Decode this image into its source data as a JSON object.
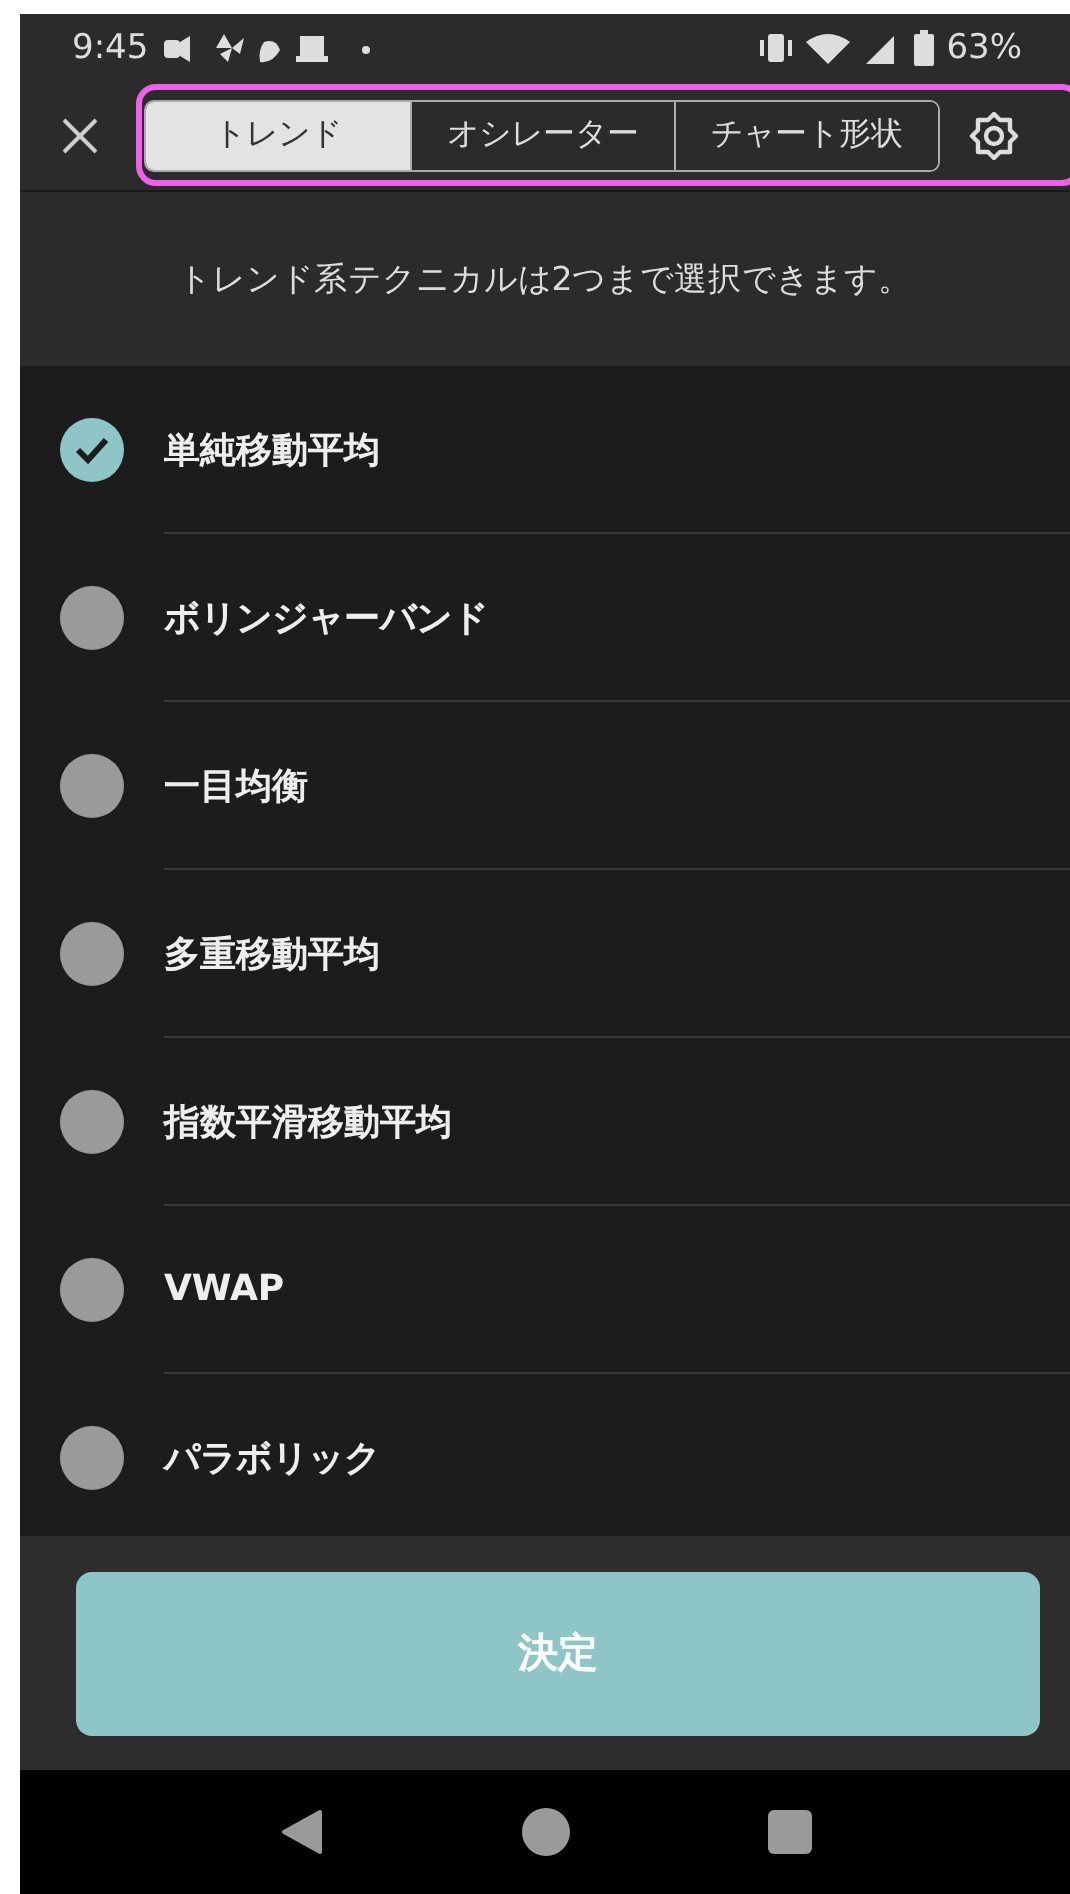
{
  "status_bar": {
    "time": "9:45",
    "battery": "63%"
  },
  "tabs": [
    {
      "label": "トレンド",
      "selected": true
    },
    {
      "label": "オシレーター",
      "selected": false
    },
    {
      "label": "チャート形状",
      "selected": false
    }
  ],
  "info": "トレンド系テクニカルは2つまで選択できます。",
  "items": [
    {
      "label": "単純移動平均",
      "selected": true
    },
    {
      "label": "ボリンジャーバンド",
      "selected": false
    },
    {
      "label": "一目均衡",
      "selected": false
    },
    {
      "label": "多重移動平均",
      "selected": false
    },
    {
      "label": "指数平滑移動平均",
      "selected": false
    },
    {
      "label": "VWAP",
      "selected": false
    },
    {
      "label": "パラボリック",
      "selected": false
    }
  ],
  "confirm_button": "決定"
}
